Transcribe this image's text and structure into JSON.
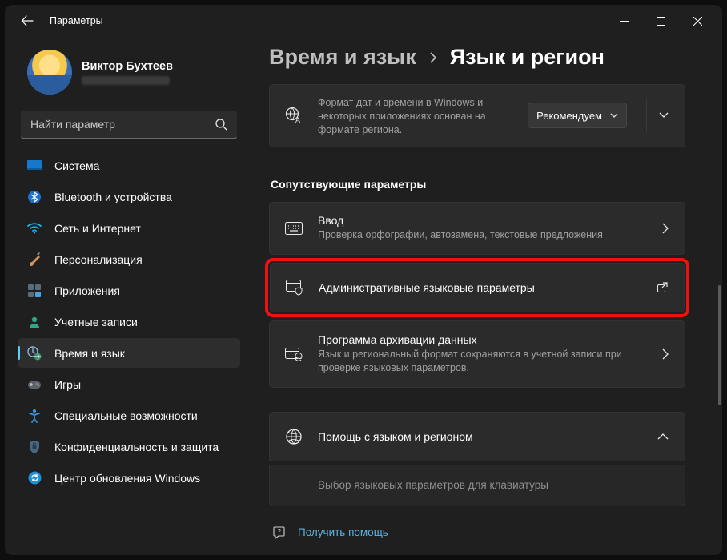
{
  "window": {
    "title": "Параметры"
  },
  "profile": {
    "name": "Виктор Бухтеев"
  },
  "search": {
    "placeholder": "Найти параметр"
  },
  "sidebar": {
    "items": [
      {
        "label": "Система"
      },
      {
        "label": "Bluetooth и устройства"
      },
      {
        "label": "Сеть и Интернет"
      },
      {
        "label": "Персонализация"
      },
      {
        "label": "Приложения"
      },
      {
        "label": "Учетные записи"
      },
      {
        "label": "Время и язык"
      },
      {
        "label": "Игры"
      },
      {
        "label": "Специальные возможности"
      },
      {
        "label": "Конфиденциальность и защита"
      },
      {
        "label": "Центр обновления Windows"
      }
    ]
  },
  "breadcrumb": {
    "parent": "Время и язык",
    "current": "Язык и регион"
  },
  "region_card": {
    "sub": "Формат дат и времени в Windows и некоторых приложениях основан на формате региона.",
    "dropdown": "Рекомендуем"
  },
  "section": {
    "related": "Сопутствующие параметры"
  },
  "cards": {
    "input": {
      "title": "Ввод",
      "sub": "Проверка орфографии, автозамена, текстовые предложения"
    },
    "admin": {
      "title": "Административные языковые параметры"
    },
    "backup": {
      "title": "Программа архивации данных",
      "sub": "Язык и региональный формат сохраняются в учетной записи при проверке языковых параметров."
    }
  },
  "help": {
    "title": "Помощь с языком и регионом",
    "sub": "Выбор языковых параметров для клавиатуры"
  },
  "footer": {
    "help": "Получить помощь"
  }
}
